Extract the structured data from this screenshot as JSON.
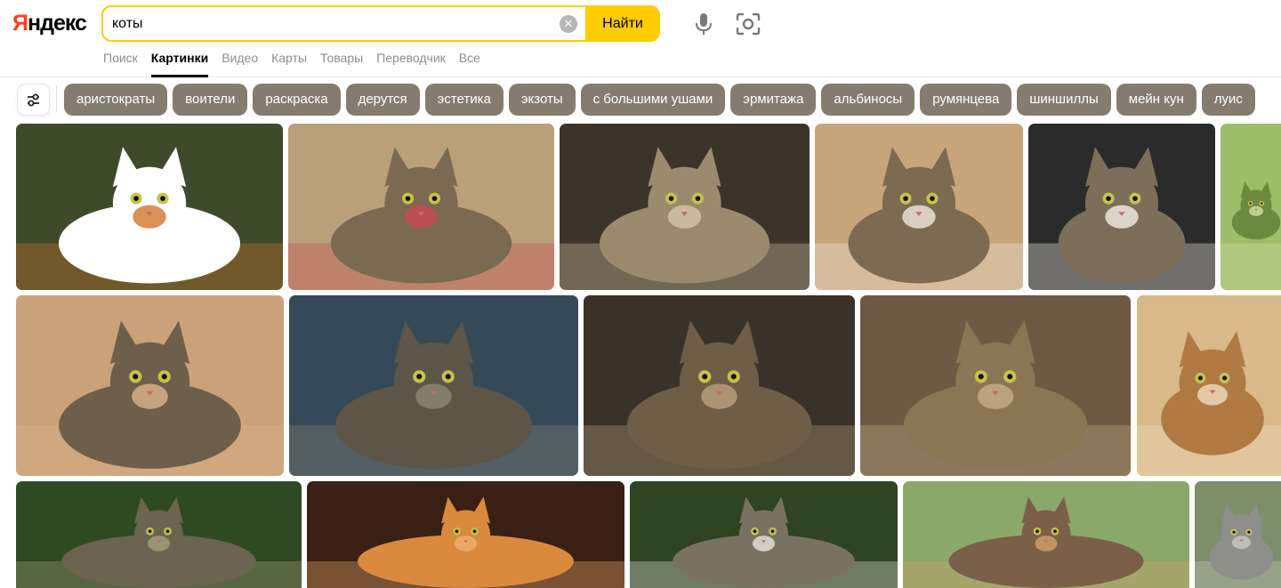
{
  "header": {
    "logo": "Яндекс",
    "search": {
      "value": "коты",
      "button": "Найти"
    },
    "tabs": [
      {
        "label": "Поиск",
        "active": false
      },
      {
        "label": "Картинки",
        "active": true
      },
      {
        "label": "Видео",
        "active": false
      },
      {
        "label": "Карты",
        "active": false
      },
      {
        "label": "Товары",
        "active": false
      },
      {
        "label": "Переводчик",
        "active": false
      },
      {
        "label": "Все",
        "active": false
      }
    ]
  },
  "filters": {
    "icon": "sliders-icon",
    "chips": [
      "аристократы",
      "воители",
      "раскраска",
      "дерутся",
      "эстетика",
      "экзоты",
      "с большими ушами",
      "эрмитажа",
      "альбиносы",
      "румянцева",
      "шиншиллы",
      "мейн кун",
      "луис"
    ]
  },
  "colors": {
    "brand": "#fc3f1d",
    "accent": "#ffcc00",
    "chip": "#847d6f"
  },
  "results": [
    {
      "bg": "#3f4a2a",
      "cat": "#ffffff",
      "accent": "#d0762e"
    },
    {
      "bg": "#b9a07a",
      "cat": "#7a6a52",
      "accent": "#c94a54"
    },
    {
      "bg": "#3c3428",
      "cat": "#9b8a6e",
      "accent": "#d6c5a8"
    },
    {
      "bg": "#c7a57a",
      "cat": "#7c6a52",
      "accent": "#efe8df"
    },
    {
      "bg": "#2b2b2b",
      "cat": "#7c6e58",
      "accent": "#f2ede6"
    },
    {
      "bg": "#9fbe6a",
      "cat": "#6b8a3e",
      "accent": "#cfe0a8"
    },
    {
      "bg": "#caa27a",
      "cat": "#6e5e4c",
      "accent": "#d9b48c"
    },
    {
      "bg": "#344a58",
      "cat": "#5c5548",
      "accent": "#8e8676"
    },
    {
      "bg": "#3a3228",
      "cat": "#6e5e48",
      "accent": "#b8a27e"
    },
    {
      "bg": "#6e5a44",
      "cat": "#8a7654",
      "accent": "#c4b08a"
    },
    {
      "bg": "#d9b88a",
      "cat": "#b07a44",
      "accent": "#f0dcc0"
    },
    {
      "bg": "#2e4a24",
      "cat": "#6a6450",
      "accent": "#a89c7c"
    },
    {
      "bg": "#3a2014",
      "cat": "#d98a3c",
      "accent": "#f0b070"
    },
    {
      "bg": "#2e4422",
      "cat": "#7a7260",
      "accent": "#e8e4dc"
    },
    {
      "bg": "#8aa86a",
      "cat": "#7a6048",
      "accent": "#d4a06a"
    },
    {
      "bg": "#7e8e6a",
      "cat": "#8e8e8a",
      "accent": "#c8c8c4"
    }
  ]
}
